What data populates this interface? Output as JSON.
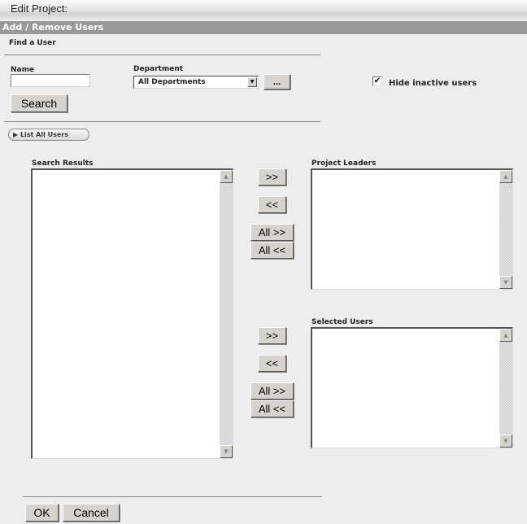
{
  "window": {
    "title": "Edit Project:"
  },
  "section": {
    "title": "Add / Remove Users"
  },
  "find_user": {
    "heading": "Find a User",
    "name_label": "Name",
    "name_value": "",
    "department_label": "Department",
    "department_selected": "All Departments",
    "browse_label": "...",
    "search_label": "Search",
    "hide_inactive_label": "Hide inactive users",
    "hide_inactive_checked": true,
    "check_glyph": "✔",
    "list_all_label": "▶ List All Users"
  },
  "lists": {
    "search_results": {
      "label": "Search Results",
      "items": []
    },
    "project_leaders": {
      "label": "Project Leaders",
      "items": []
    },
    "selected_users": {
      "label": "Selected Users",
      "items": []
    }
  },
  "transfer": {
    "add": ">>",
    "remove": "<<",
    "add_all": "All >>",
    "remove_all": "All <<"
  },
  "icons": {
    "scroll_up": "▲",
    "scroll_down": "▼",
    "dropdown": "▼"
  },
  "footer": {
    "ok_label": "OK",
    "cancel_label": "Cancel"
  }
}
